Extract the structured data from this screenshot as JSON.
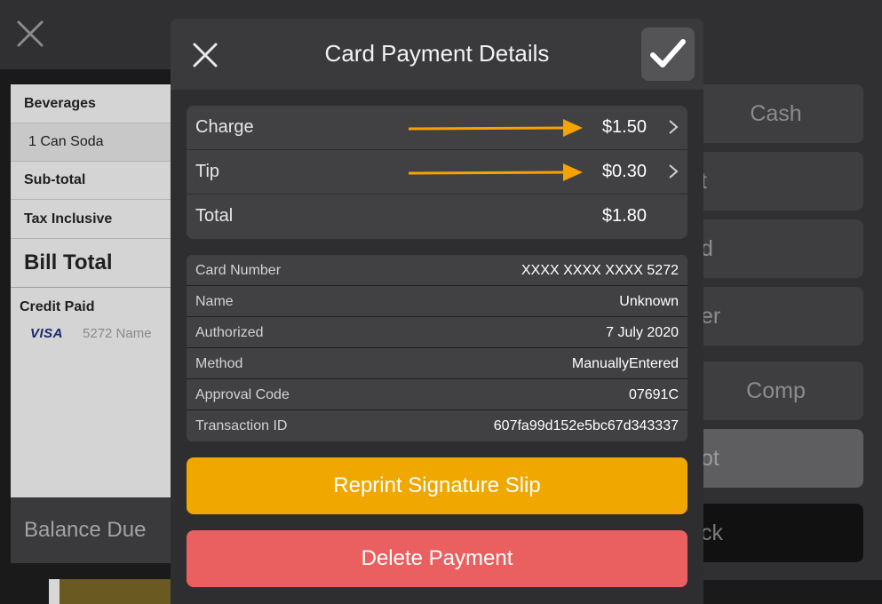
{
  "bill": {
    "beverages": "Beverages",
    "item": "1 Can Soda",
    "subtotal": "Sub-total",
    "tax": "Tax Inclusive",
    "bill_total": "Bill Total",
    "credit_paid": "Credit Paid",
    "card_brand": "VISA",
    "card_name": "5272 Name",
    "balance_due": "Balance Due"
  },
  "payment_options": [
    "Cash",
    "t",
    "d",
    "er",
    "Comp",
    "ot",
    "ck"
  ],
  "modal": {
    "title": "Card Payment Details",
    "amounts": [
      {
        "label": "Charge",
        "value": "$1.50",
        "editable": true
      },
      {
        "label": "Tip",
        "value": "$0.30",
        "editable": true
      },
      {
        "label": "Total",
        "value": "$1.80",
        "editable": false
      }
    ],
    "details": [
      {
        "label": "Card Number",
        "value": "XXXX XXXX XXXX 5272"
      },
      {
        "label": "Name",
        "value": "Unknown"
      },
      {
        "label": "Authorized",
        "value": "7 July 2020"
      },
      {
        "label": "Method",
        "value": "ManuallyEntered"
      },
      {
        "label": "Approval Code",
        "value": "07691C"
      },
      {
        "label": "Transaction ID",
        "value": "607fa99d152e5bc67d343337"
      }
    ],
    "reprint_label": "Reprint Signature Slip",
    "delete_label": "Delete Payment"
  },
  "colors": {
    "accent_orange": "#f0a800",
    "delete_red": "#ea6060",
    "annotation_arrow": "#f5a300"
  },
  "icons": {
    "close": "close-icon",
    "confirm": "checkmark-icon",
    "chevron": "chevron-right-icon",
    "annotation": "arrow-right-icon"
  }
}
